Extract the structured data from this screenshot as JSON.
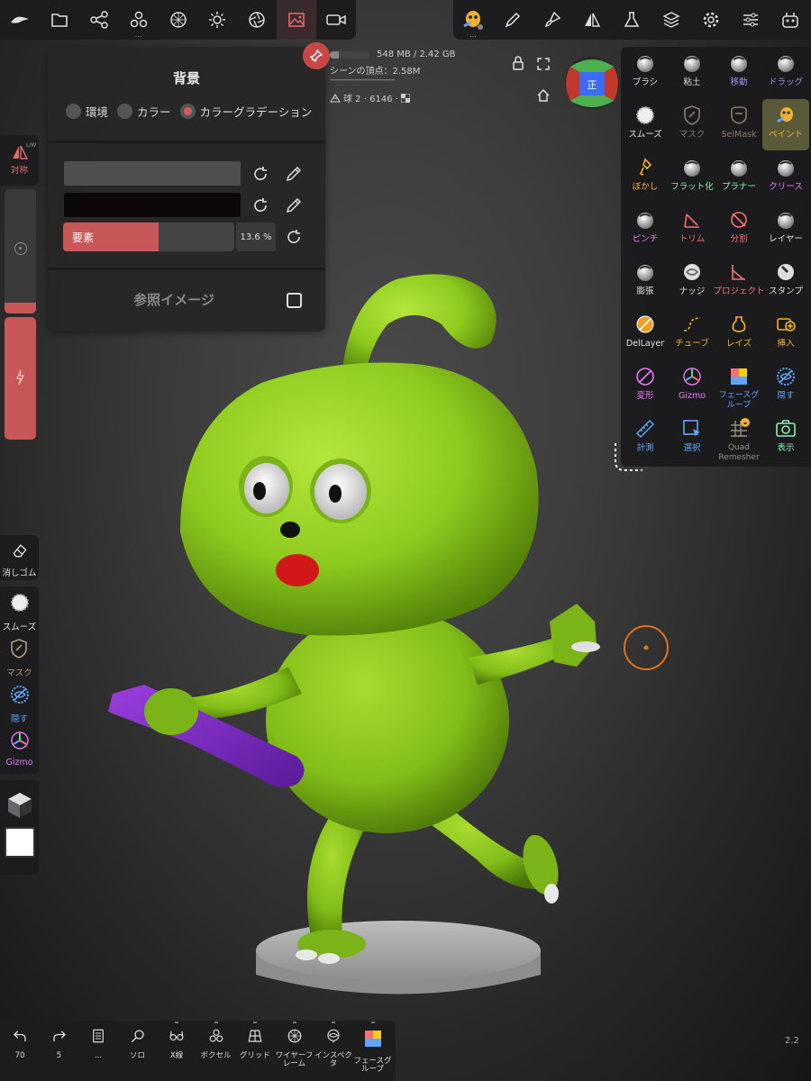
{
  "colors": {
    "accent_red": "#c85757",
    "tool_gold": "#f0b030",
    "tool_violet": "#a78bfa",
    "tool_blue": "#60a5fa",
    "tool_pink": "#e879f9",
    "tool_green": "#86efac",
    "character_green": "#8ecb1e"
  },
  "top_left_toolbar": {
    "icons": [
      "logo-icon",
      "folder-icon",
      "share-icon",
      "scene-icon",
      "material-icon",
      "light-icon",
      "aperture-icon",
      "image-icon",
      "camera-icon"
    ],
    "more_marker": "..."
  },
  "top_right_toolbar": {
    "icons": [
      "paint-tool-icon",
      "pen-icon",
      "brush-icon",
      "symmetry-icon",
      "flask-icon",
      "layers-icon",
      "gear-icon",
      "sliders-icon",
      "mascot-icon"
    ],
    "more_marker": "..."
  },
  "background_panel": {
    "title": "背景",
    "radio_options": [
      "環境",
      "カラー",
      "カラーグラデーション"
    ],
    "selected_option": "カラーグラデーション",
    "swatch1_color": "#4e4e50",
    "swatch2_color": "#0c0809",
    "slider_label": "要素",
    "slider_value": "13.6 %",
    "slider_fraction": 0.136,
    "reference_label": "参照イメージ"
  },
  "scene_info": {
    "memory": "548 MB / 2.42 GB",
    "memory_fraction": 0.22,
    "vertices": "シーンの頂点：2.58M",
    "dash_line": "--------------------------------------",
    "object": "球 2 · 6146 ·"
  },
  "view_cube_label": "正",
  "tools": [
    {
      "label": "ブラシ",
      "color": "#e0e0e0",
      "icon": "sphere-icon"
    },
    {
      "label": "粘土",
      "color": "#e0e0e0",
      "icon": "sphere-icon"
    },
    {
      "label": "移動",
      "color": "#a78bfa",
      "icon": "sphere-icon"
    },
    {
      "label": "ドラッグ",
      "color": "#a78bfa",
      "icon": "sphere-icon"
    },
    {
      "label": "スムーズ",
      "color": "#e0e0e0",
      "icon": "smooth-icon"
    },
    {
      "label": "マスク",
      "color": "#8a7a6a",
      "icon": "mask-icon"
    },
    {
      "label": "SelMask",
      "color": "#8a7a6a",
      "icon": "selmask-icon"
    },
    {
      "label": "ペイント",
      "color": "#f0b030",
      "icon": "paint-icon"
    },
    {
      "label": "ぼかし",
      "color": "#f0b030",
      "icon": "blur-icon"
    },
    {
      "label": "フラット化",
      "color": "#86efac",
      "icon": "sphere-icon"
    },
    {
      "label": "プラナー",
      "color": "#86efac",
      "icon": "sphere-icon"
    },
    {
      "label": "クリース",
      "color": "#e879f9",
      "icon": "sphere-icon"
    },
    {
      "label": "ピンチ",
      "color": "#e879f9",
      "icon": "sphere-icon"
    },
    {
      "label": "トリム",
      "color": "#f87171",
      "icon": "trim-icon"
    },
    {
      "label": "分割",
      "color": "#f87171",
      "icon": "split-icon"
    },
    {
      "label": "レイヤー",
      "color": "#e0e0e0",
      "icon": "sphere-icon"
    },
    {
      "label": "膨張",
      "color": "#e0e0e0",
      "icon": "sphere-icon"
    },
    {
      "label": "ナッジ",
      "color": "#e0e0e0",
      "icon": "nudge-icon"
    },
    {
      "label": "プロジェクト",
      "color": "#f87171",
      "icon": "project-icon"
    },
    {
      "label": "スタンプ",
      "color": "#e0e0e0",
      "icon": "stamp-icon"
    },
    {
      "label": "DelLayer",
      "color": "#e0e0e0",
      "icon": "dellayer-icon"
    },
    {
      "label": "チューブ",
      "color": "#f0b030",
      "icon": "tube-icon"
    },
    {
      "label": "レイズ",
      "color": "#f0b030",
      "icon": "raise-icon"
    },
    {
      "label": "挿入",
      "color": "#f0b030",
      "icon": "insert-icon"
    },
    {
      "label": "変形",
      "color": "#e879f9",
      "icon": "transform-icon"
    },
    {
      "label": "Gizmo",
      "color": "#e879f9",
      "icon": "gizmo-icon"
    },
    {
      "label": "フェースグループ",
      "color": "#60a5fa",
      "icon": "facegroup-icon"
    },
    {
      "label": "隠す",
      "color": "#60a5fa",
      "icon": "hide-icon"
    },
    {
      "label": "計測",
      "color": "#60a5fa",
      "icon": "ruler-icon"
    },
    {
      "label": "選択",
      "color": "#60a5fa",
      "icon": "select-icon"
    },
    {
      "label": "Quad Remesher",
      "color": "#9a8f80",
      "icon": "remesher-icon"
    },
    {
      "label": "表示",
      "color": "#86efac",
      "icon": "camera-icon"
    }
  ],
  "selected_tool": "ペイント",
  "symmetry": {
    "label": "対称",
    "badge": "L/W"
  },
  "left_tools": [
    {
      "label": "消しゴム",
      "icon": "eraser-icon",
      "color": "#e0e0e0"
    },
    {
      "label": "スムーズ",
      "icon": "smooth-icon",
      "color": "#e0e0e0"
    },
    {
      "label": "マスク",
      "icon": "mask-icon",
      "color": "#b09a80"
    },
    {
      "label": "隠す",
      "icon": "hide-icon",
      "color": "#60a5fa"
    },
    {
      "label": "Gizmo",
      "icon": "gizmo-icon",
      "color": "#e879f9"
    }
  ],
  "bottom_tools": [
    {
      "label": "70",
      "icon": "undo-icon"
    },
    {
      "label": "5",
      "icon": "redo-icon"
    },
    {
      "label": "...",
      "icon": "book-icon"
    },
    {
      "label": "ソロ",
      "icon": "search-icon"
    },
    {
      "label": "X線",
      "icon": "glasses-icon"
    },
    {
      "label": "ボクセル",
      "icon": "voxel-icon"
    },
    {
      "label": "グリッド",
      "icon": "grid-icon"
    },
    {
      "label": "ワイヤーフレーム",
      "icon": "wireframe-icon"
    },
    {
      "label": "インスペクタ",
      "icon": "inspector-icon"
    },
    {
      "label": "フェースグループ",
      "icon": "facegroup-icon"
    }
  ],
  "version": "2.2"
}
